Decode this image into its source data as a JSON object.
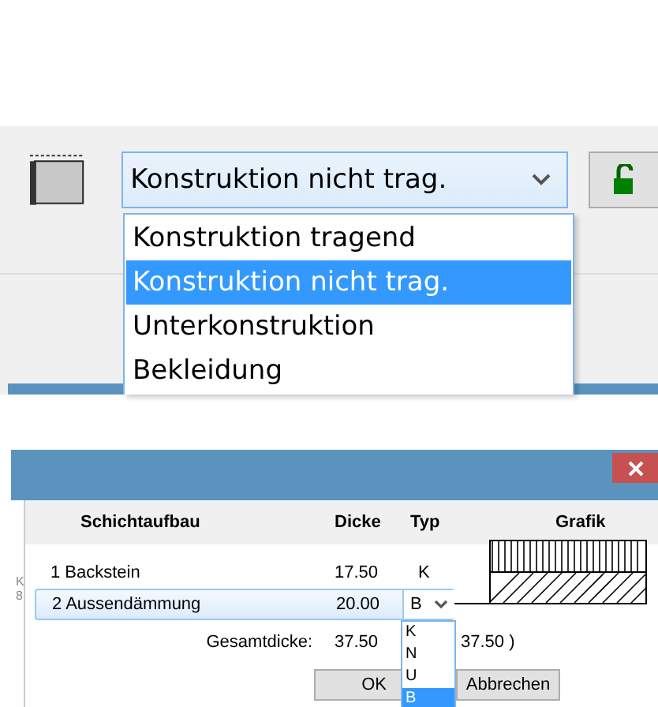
{
  "toolbar": {
    "combo": {
      "value": "Konstruktion nicht trag."
    },
    "options": [
      {
        "label": "Konstruktion tragend",
        "selected": false
      },
      {
        "label": "Konstruktion nicht trag.",
        "selected": true
      },
      {
        "label": "Unterkonstruktion",
        "selected": false
      },
      {
        "label": "Bekleidung",
        "selected": false
      }
    ]
  },
  "dialog": {
    "columns": [
      "Schichtaufbau",
      "Dicke",
      "Typ",
      "Grafik"
    ],
    "side_marks": [
      "K",
      "8"
    ],
    "rows": [
      {
        "name": "1 Backstein",
        "thickness": "17.50",
        "type": "K",
        "selected": false,
        "kind": "vertical"
      },
      {
        "name": "2 Aussendämmung",
        "thickness": "20.00",
        "type": "B",
        "selected": true,
        "kind": "diagonal"
      }
    ],
    "total_label": "Gesamtdicke:",
    "total": "37.50",
    "total_extra": "37.50 )",
    "type_options": [
      {
        "label": "K",
        "selected": false
      },
      {
        "label": "N",
        "selected": false
      },
      {
        "label": "U",
        "selected": false
      },
      {
        "label": "B",
        "selected": true
      }
    ],
    "buttons": [
      "OK",
      "Abbrechen"
    ]
  }
}
